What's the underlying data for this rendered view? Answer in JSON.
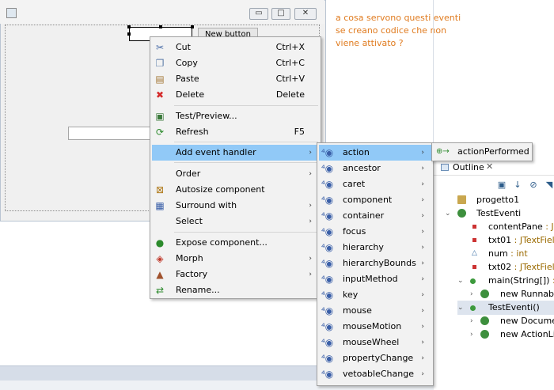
{
  "window": {
    "min_glyph": "▭",
    "max_glyph": "□",
    "close_glyph": "✕",
    "new_button_label": "New button"
  },
  "note": {
    "text": "a cosa servono questi eventi se creano codice che non viene attivato ?"
  },
  "context_menu": {
    "items": [
      {
        "label": "Cut",
        "shortcut": "Ctrl+X",
        "icon": "scissors-icon"
      },
      {
        "label": "Copy",
        "shortcut": "Ctrl+C",
        "icon": "copy-icon"
      },
      {
        "label": "Paste",
        "shortcut": "Ctrl+V",
        "icon": "paste-icon"
      },
      {
        "label": "Delete",
        "shortcut": "Delete",
        "icon": "delete-x-icon"
      },
      {
        "label": "Test/Preview...",
        "shortcut": "",
        "icon": "preview-icon"
      },
      {
        "label": "Refresh",
        "shortcut": "F5",
        "icon": "refresh-icon"
      },
      {
        "label": "Add event handler",
        "shortcut": "",
        "icon": ""
      },
      {
        "label": "Order",
        "shortcut": "",
        "icon": ""
      },
      {
        "label": "Autosize component",
        "shortcut": "",
        "icon": "autosize-icon"
      },
      {
        "label": "Surround with",
        "shortcut": "",
        "icon": "surround-icon"
      },
      {
        "label": "Select",
        "shortcut": "",
        "icon": ""
      },
      {
        "label": "Expose component...",
        "shortcut": "",
        "icon": "expose-icon"
      },
      {
        "label": "Morph",
        "shortcut": "",
        "icon": "morph-icon"
      },
      {
        "label": "Factory",
        "shortcut": "",
        "icon": "factory-icon"
      },
      {
        "label": "Rename...",
        "shortcut": "",
        "icon": "rename-icon"
      }
    ]
  },
  "event_submenu": {
    "items": [
      "action",
      "ancestor",
      "caret",
      "component",
      "container",
      "focus",
      "hierarchy",
      "hierarchyBounds",
      "inputMethod",
      "key",
      "mouse",
      "mouseMotion",
      "mouseWheel",
      "propertyChange",
      "vetoableChange"
    ]
  },
  "action_submenu": {
    "items": [
      "actionPerformed"
    ]
  },
  "outline": {
    "tab_label": "Outline",
    "close_glyph": "✕",
    "tree": [
      {
        "name": "progetto1",
        "type": ""
      },
      {
        "name": "TestEventi",
        "type": ""
      },
      {
        "name": "contentPane",
        "type": " : JPa"
      },
      {
        "name": "txt01",
        "type": " : JTextField"
      },
      {
        "name": "num",
        "type": " : int"
      },
      {
        "name": "txt02",
        "type": " : JTextField"
      },
      {
        "name": "main(String[])",
        "type": " : v"
      },
      {
        "name": "new Runnable",
        "type": ""
      },
      {
        "name": "TestEventi()",
        "type": ""
      },
      {
        "name": "new Documen",
        "type": ""
      },
      {
        "name": "new ActionLis",
        "type": ""
      }
    ]
  },
  "colors": {
    "menu_highlight": "#91c9f7",
    "note_text": "#e07b1f",
    "type_text": "#9b6a00"
  }
}
